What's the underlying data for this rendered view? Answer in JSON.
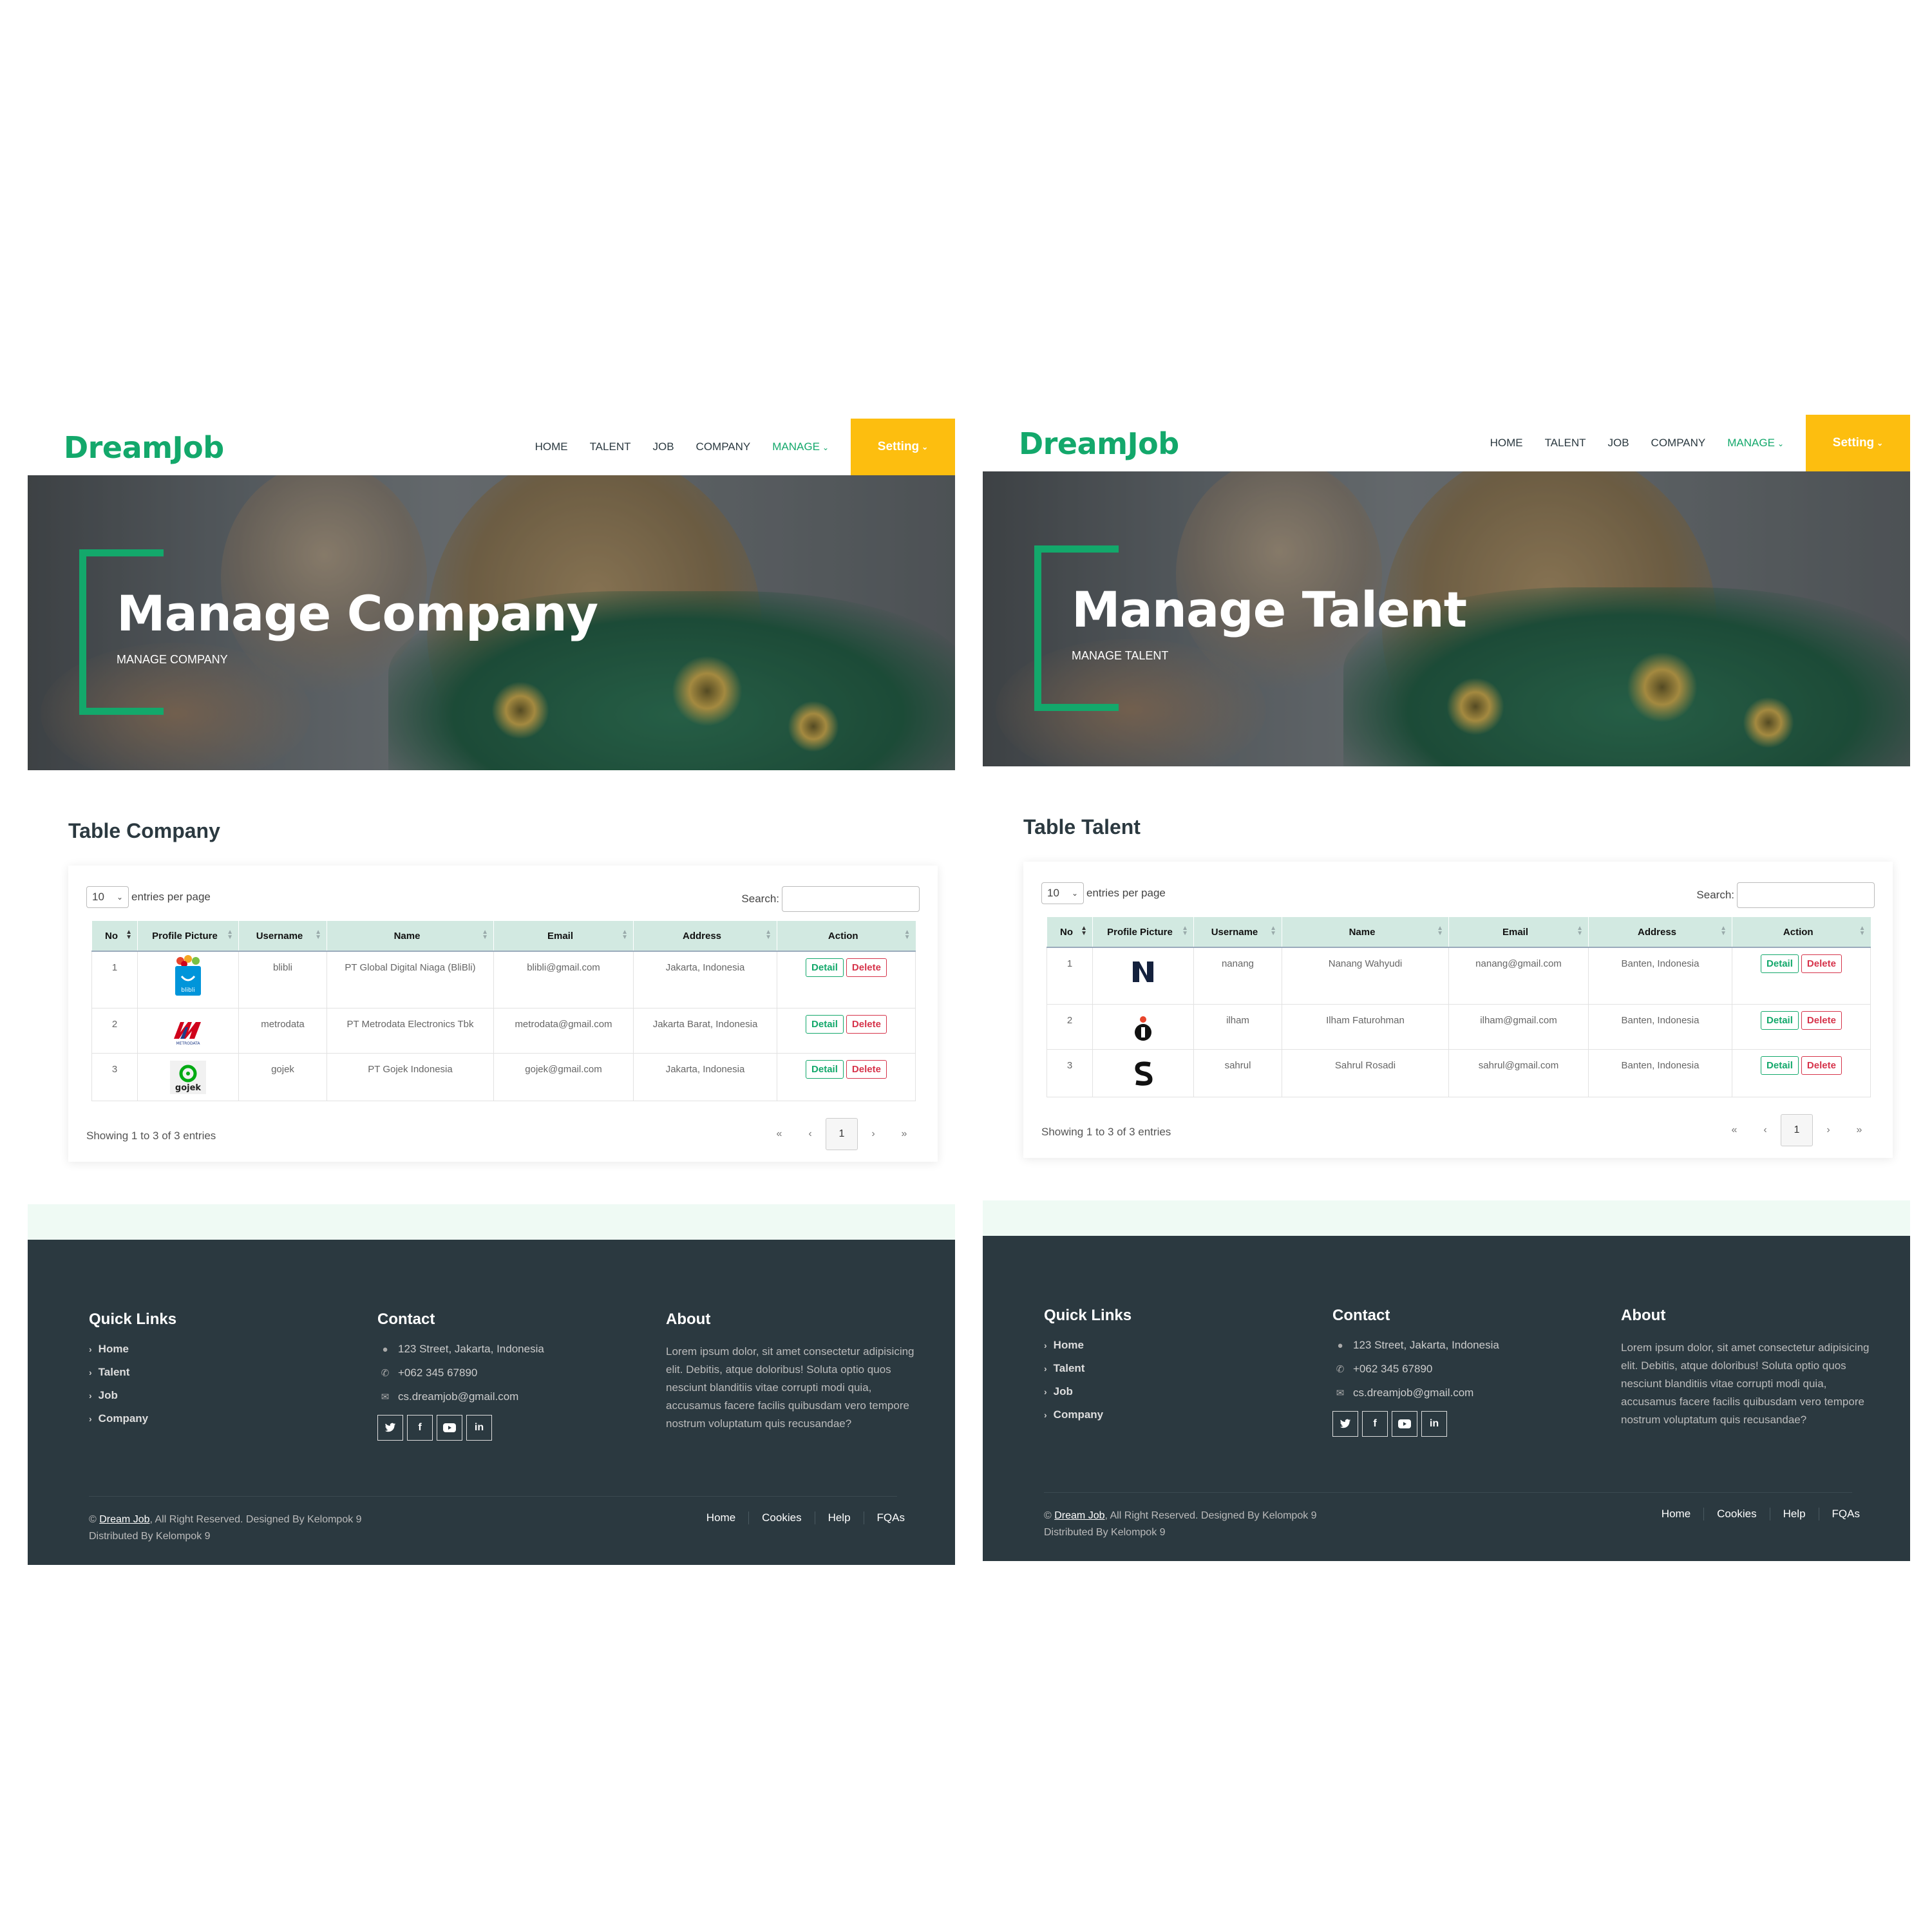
{
  "brand": "DreamJob",
  "colors": {
    "accent": "#13a86b",
    "setting": "#fdbe0f",
    "footer": "#2b3940",
    "table_header": "#d2e9e1"
  },
  "nav": {
    "links": [
      "HOME",
      "TALENT",
      "JOB",
      "COMPANY",
      "MANAGE"
    ],
    "setting": "Setting"
  },
  "left": {
    "hero_title": "Manage Company",
    "hero_sub": "MANAGE COMPANY",
    "table_title": "Table Company",
    "length_value": "10",
    "length_label": "entries per page",
    "search_label": "Search:",
    "columns": [
      "No",
      "Profile Picture",
      "Username",
      "Name",
      "Email",
      "Address",
      "Action"
    ],
    "rows": [
      {
        "no": "1",
        "pic": "blibli-logo",
        "username": "blibli",
        "name": "PT Global Digital Niaga (BliBli)",
        "email": "blibli@gmail.com",
        "address": "Jakarta, Indonesia"
      },
      {
        "no": "2",
        "pic": "metrodata-logo",
        "username": "metrodata",
        "name": "PT Metrodata Electronics Tbk",
        "email": "metrodata@gmail.com",
        "address": "Jakarta Barat, Indonesia"
      },
      {
        "no": "3",
        "pic": "gojek-logo",
        "username": "gojek",
        "name": "PT Gojek Indonesia",
        "email": "gojek@gmail.com",
        "address": "Jakarta, Indonesia"
      }
    ],
    "info": "Showing 1 to 3 of 3 entries"
  },
  "right": {
    "hero_title": "Manage Talent",
    "hero_sub": "MANAGE TALENT",
    "table_title": "Table Talent",
    "length_value": "10",
    "length_label": "entries per page",
    "search_label": "Search:",
    "columns": [
      "No",
      "Profile Picture",
      "Username",
      "Name",
      "Email",
      "Address",
      "Action"
    ],
    "rows": [
      {
        "no": "1",
        "pic": "letter-n-logo",
        "username": "nanang",
        "name": "Nanang Wahyudi",
        "email": "nanang@gmail.com",
        "address": "Banten, Indonesia"
      },
      {
        "no": "2",
        "pic": "letter-i-logo",
        "username": "ilham",
        "name": "Ilham Faturohman",
        "email": "ilham@gmail.com",
        "address": "Banten, Indonesia"
      },
      {
        "no": "3",
        "pic": "letter-s-logo",
        "username": "sahrul",
        "name": "Sahrul Rosadi",
        "email": "sahrul@gmail.com",
        "address": "Banten, Indonesia"
      }
    ],
    "info": "Showing 1 to 3 of 3 entries"
  },
  "actions": {
    "detail": "Detail",
    "delete": "Delete"
  },
  "pager": {
    "first": "«",
    "prev": "‹",
    "current": "1",
    "next": "›",
    "last": "»"
  },
  "footer": {
    "quick_title": "Quick Links",
    "quick_links": [
      "Home",
      "Talent",
      "Job",
      "Company"
    ],
    "contact_title": "Contact",
    "address": "123 Street, Jakarta, Indonesia",
    "phone": "+062 345 67890",
    "email": "cs.dreamjob@gmail.com",
    "socials": [
      "twitter-icon",
      "facebook-icon",
      "youtube-icon",
      "linkedin-icon"
    ],
    "about_title": "About",
    "about_text": "Lorem ipsum dolor, sit amet consectetur adipisicing elit. Debitis, atque doloribus! Soluta optio quos nesciunt blanditiis vitae corrupti modi quia, accusamus facere facilis quibusdam vero tempore nostrum voluptatum quis recusandae?",
    "copy_symbol": "©",
    "copy_link": "Dream Job",
    "copy_rest": ", All Right Reserved. Designed By Kelompok 9",
    "copy_line2": "Distributed By Kelompok 9",
    "menu": [
      "Home",
      "Cookies",
      "Help",
      "FQAs"
    ]
  }
}
